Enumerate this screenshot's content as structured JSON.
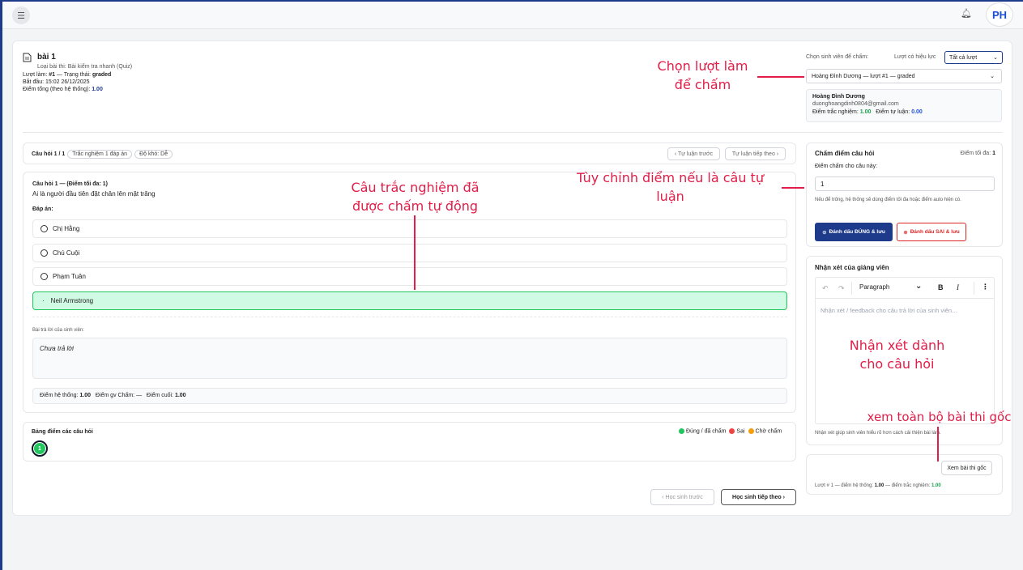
{
  "header": {
    "menu_icon": "hamburger-icon",
    "bell_icon": "bell-icon",
    "avatar_initials": "PH"
  },
  "submission": {
    "title": "bài 1",
    "type_label": "Loại bài thi: ",
    "type_value": "Bài kiểm tra nhanh (Quiz)",
    "attempt_prefix": "Lượt làm: ",
    "attempt_value": "#1",
    "status_prefix": " — Trạng thái: ",
    "status_value": "graded",
    "start_label": "Bắt đầu: 15:02 26/12/2025",
    "total_prefix": "Điểm tổng (theo hệ thống): ",
    "total_value": "1.00"
  },
  "selector": {
    "student_label": "Chọn sinh viên để chấm:",
    "valid_label": "Lượt có hiệu lực",
    "valid_value": "Tất cả lượt",
    "student_value": "Hoàng Đình Dương — lượt #1 — graded"
  },
  "student_info": {
    "name": "Hoàng Đình Dương",
    "email": "duonghoangdinh0804@gmail.com",
    "mc_label": "Điểm trắc nghiệm: ",
    "mc_value": "1.00",
    "essay_label": "Điểm tự luận: ",
    "essay_value": "0.00"
  },
  "question_bar": {
    "counter": "Câu hỏi 1 / 1",
    "type_pill": "Trắc nghiệm 1 đáp án",
    "difficulty_pill": "Độ khó: Dễ",
    "prev_essay": "‹ Tự luận trước",
    "next_essay": "Tự luận tiếp theo ›"
  },
  "question": {
    "heading": "Câu hỏi 1 — (Điểm tối đa: 1)",
    "text": "Ai là người đầu tiên đặt chân lên mặt trăng",
    "answers_label": "Đáp án:",
    "options": [
      "Chị Hằng",
      "Chú Cuội",
      "Phạm Tuân",
      "Neil Armstrong"
    ],
    "student_answer_label": "Bài trả lời của sinh viên:",
    "student_answer": "Chưa trả lời",
    "score_system_label": "Điểm hệ thống: ",
    "score_system_value": "1.00",
    "score_teacher_label": "Điểm gv Chấm: ",
    "score_teacher_value": "—",
    "score_final_label": "Điểm cuối: ",
    "score_final_value": "1.00"
  },
  "score_table": {
    "title": "Bảng điểm các câu hỏi",
    "items": [
      "1"
    ],
    "legend_correct": "Đúng / đã chấm",
    "legend_wrong": "Sai",
    "legend_pending": "Chờ chấm",
    "color_correct": "#22c55e",
    "color_wrong": "#ef4444",
    "color_pending": "#f59e0b"
  },
  "navigation": {
    "prev_student": "‹ Học sinh trước",
    "next_student": "Học sinh tiếp theo ›"
  },
  "grading": {
    "title": "Chấm điểm câu hỏi",
    "max_label": "Điểm tối đa: ",
    "max_value": "1",
    "input_label": "Điểm chấm cho câu này:",
    "input_value": "1",
    "hint": "Nếu để trống, hệ thống sẽ dùng điểm tối đa hoặc điểm auto hiện có.",
    "mark_correct": "Đánh dấu ĐÚNG & lưu",
    "mark_wrong": "Đánh dấu SAI & lưu"
  },
  "feedback": {
    "title": "Nhận xét của giảng viên",
    "format": "Paragraph",
    "placeholder": "Nhận xét / feedback cho câu trả lời của sinh viên...",
    "hint": "Nhận xét giúp sinh viên hiểu rõ hơn cách cải thiện bài làm."
  },
  "original": {
    "view_button": "Xem bài thi gốc",
    "summary_prefix": "Lượt # 1 — điểm hệ thống: ",
    "summary_system": "1.00",
    "summary_mid": " — điểm trắc nghiệm: ",
    "summary_mc": "1.00"
  },
  "annotations": {
    "choose_attempt_1": "Chọn lượt làm",
    "choose_attempt_2": "để chấm",
    "auto_graded_1": "Câu trắc nghiệm đã",
    "auto_graded_2": "được chấm tự động",
    "custom_score_1": "Tùy chỉnh điểm nếu là câu tự",
    "custom_score_2": "luận",
    "feedback_note_1": "Nhận xét dành",
    "feedback_note_2": "cho câu hỏi",
    "view_original": "xem toàn bộ bài thi gốc"
  },
  "colors": {
    "accent": "#1e3a8a",
    "annotation": "#e11d48",
    "success": "#22c55e"
  }
}
